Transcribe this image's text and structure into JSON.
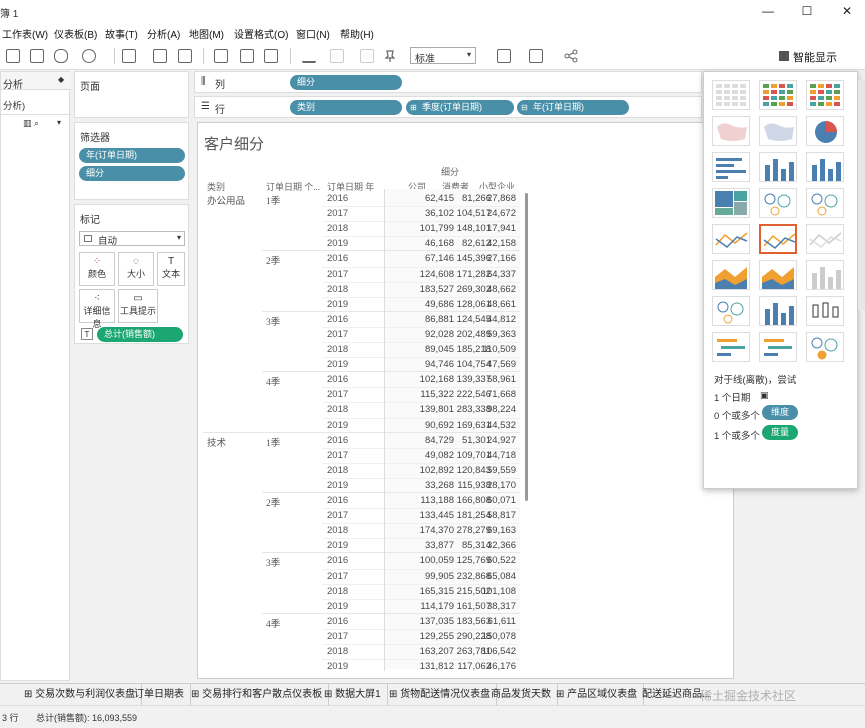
{
  "window": {
    "title": "簿 1",
    "min": "—",
    "max": "☐",
    "close": "✕"
  },
  "menu": [
    "工作表(W)",
    "仪表板(B)",
    "故事(T)",
    "分析(A)",
    "地图(M)",
    "设置格式(O)",
    "窗口(N)",
    "帮助(H)"
  ],
  "toolbar": {
    "fit_value": "标准",
    "smart_label": "智能显示"
  },
  "left_pane": {
    "title": "分析",
    "item": "分析)"
  },
  "pages": {
    "title": "页面"
  },
  "filters": {
    "title": "筛选器",
    "items": [
      "年(订单日期)",
      "细分"
    ]
  },
  "marks": {
    "title": "标记",
    "type": "自动",
    "buttons": [
      "颜色",
      "大小",
      "文本",
      "详细信息",
      "工具提示"
    ],
    "sum_pill": "总计(销售额)"
  },
  "shelves": {
    "columns_label": "列",
    "rows_label": "行",
    "columns": [
      "细分"
    ],
    "rows": [
      "类别",
      "季度(订单日期)",
      "年(订单日期)"
    ]
  },
  "view": {
    "title": "客户细分",
    "segment_header": "细分",
    "col_headers": [
      "类别",
      "订单日期 个...",
      "订单日期 年",
      "公司",
      "消费者",
      "小型企业"
    ],
    "categories": [
      {
        "name": "办公用品",
        "quarters": [
          {
            "q": "1季",
            "rows": [
              [
                "2016",
                "62,415",
                "81,266",
                "27,868"
              ],
              [
                "2017",
                "36,102",
                "104,517",
                "24,672"
              ],
              [
                "2018",
                "101,799",
                "148,101",
                "17,941"
              ],
              [
                "2019",
                "46,168",
                "82,612",
                "42,158"
              ]
            ]
          },
          {
            "q": "2季",
            "rows": [
              [
                "2016",
                "67,146",
                "145,396",
                "27,166"
              ],
              [
                "2017",
                "124,608",
                "171,282",
                "64,337"
              ],
              [
                "2018",
                "183,527",
                "269,302",
                "48,662"
              ],
              [
                "2019",
                "49,686",
                "128,061",
                "48,661"
              ]
            ]
          },
          {
            "q": "3季",
            "rows": [
              [
                "2016",
                "86,881",
                "124,545",
                "44,812"
              ],
              [
                "2017",
                "92,028",
                "202,489",
                "59,363"
              ],
              [
                "2018",
                "89,045",
                "185,218",
                "110,509"
              ],
              [
                "2019",
                "94,746",
                "104,754",
                "47,569"
              ]
            ]
          },
          {
            "q": "4季",
            "rows": [
              [
                "2016",
                "102,168",
                "139,337",
                "58,961"
              ],
              [
                "2017",
                "115,322",
                "222,546",
                "71,668"
              ],
              [
                "2018",
                "139,801",
                "283,338",
                "98,224"
              ],
              [
                "2019",
                "90,692",
                "169,631",
                "44,532"
              ]
            ]
          }
        ]
      },
      {
        "name": "技术",
        "quarters": [
          {
            "q": "1季",
            "rows": [
              [
                "2016",
                "84,729",
                "51,301",
                "24,927"
              ],
              [
                "2017",
                "49,082",
                "109,701",
                "44,718"
              ],
              [
                "2018",
                "102,892",
                "120,843",
                "59,559"
              ],
              [
                "2019",
                "33,268",
                "115,938",
                "28,170"
              ]
            ]
          },
          {
            "q": "2季",
            "rows": [
              [
                "2016",
                "113,188",
                "166,808",
                "60,071"
              ],
              [
                "2017",
                "133,445",
                "181,254",
                "58,817"
              ],
              [
                "2018",
                "174,370",
                "278,279",
                "69,163"
              ],
              [
                "2019",
                "33,877",
                "85,314",
                "32,366"
              ]
            ]
          },
          {
            "q": "3季",
            "rows": [
              [
                "2016",
                "100,059",
                "125,769",
                "60,522"
              ],
              [
                "2017",
                "99,905",
                "232,868",
                "65,084"
              ],
              [
                "2018",
                "165,315",
                "215,502",
                "101,108"
              ],
              [
                "2019",
                "114,179",
                "161,507",
                "38,317"
              ]
            ]
          },
          {
            "q": "4季",
            "rows": [
              [
                "2016",
                "137,035",
                "183,563",
                "61,611"
              ],
              [
                "2017",
                "129,255",
                "290,228",
                "150,078"
              ],
              [
                "2018",
                "163,207",
                "263,781",
                "106,542"
              ],
              [
                "2019",
                "131,812",
                "117,062",
                "46,176"
              ]
            ]
          }
        ]
      }
    ]
  },
  "showme": {
    "hint": "对于线(离散)，尝试",
    "line1": "1 个日期",
    "line2_prefix": "0 个或多个",
    "line2_badge": "维度",
    "line3_prefix": "1 个或多个",
    "line3_badge": "度量",
    "colors": {
      "orange": "#f0a030",
      "blue": "#4a7fb0",
      "teal": "#4aa3a3",
      "red": "#d9534f",
      "green": "#59a14f"
    }
  },
  "tabs": [
    "交易次数与利润仪表盘",
    "订单日期表",
    "交易排行和客户散点仪表板",
    "数据大屏1",
    "货物配送情况仪表盘",
    "商品发货天数",
    "产品区域仪表盘",
    "配送延迟商品..."
  ],
  "status": {
    "text": "总计(销售额): 16,093,559",
    "prefix": "3 行"
  },
  "watermark": "稀土掘金技术社区"
}
